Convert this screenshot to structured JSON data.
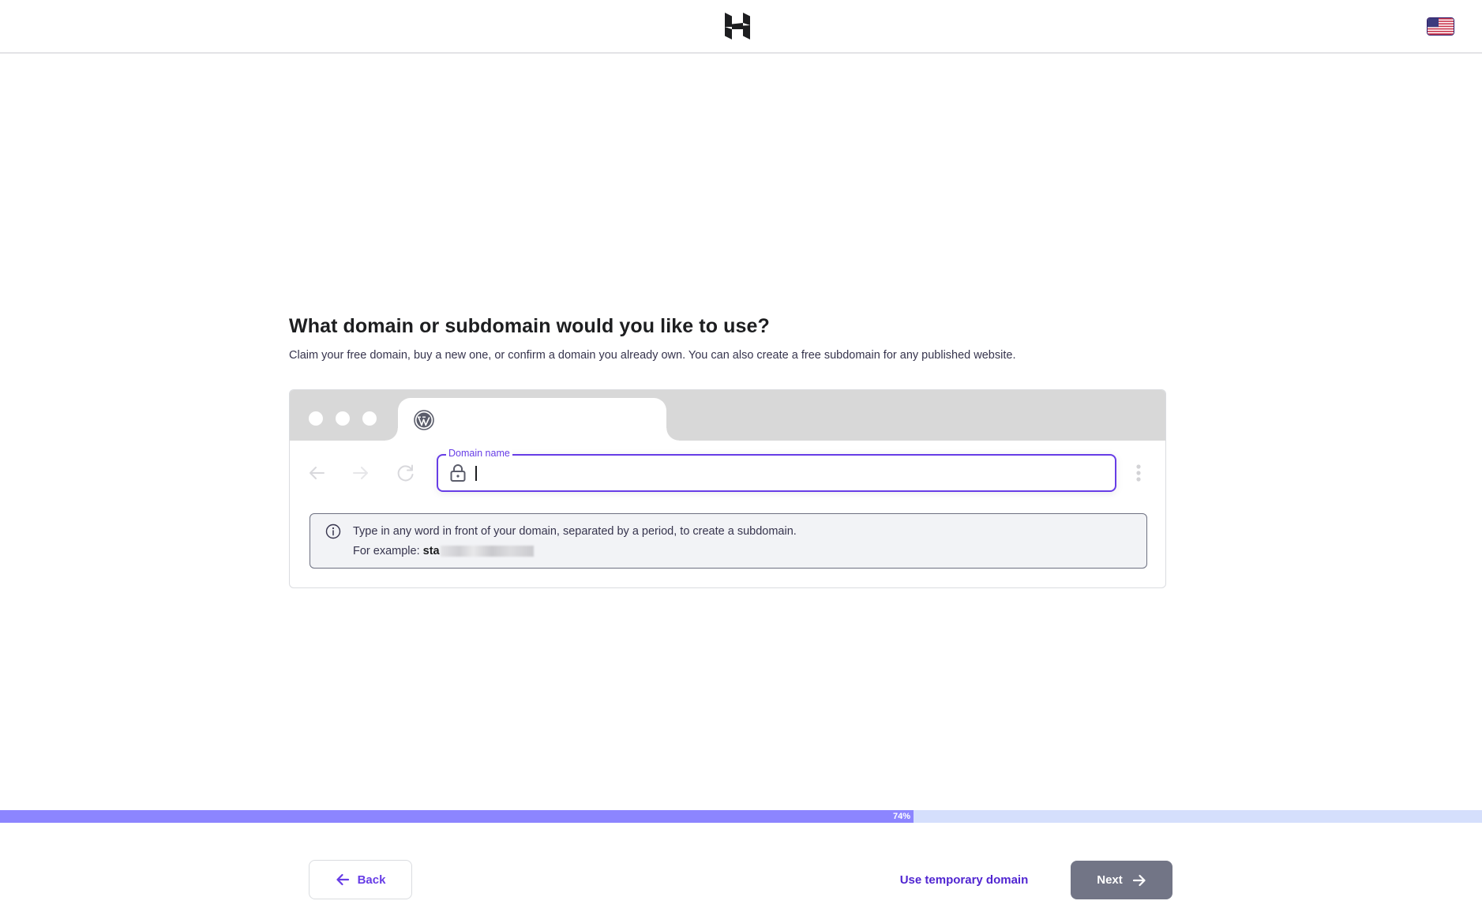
{
  "header": {
    "logo_icon": "hostinger-h-logo-icon",
    "language_icon": "us-flag-icon"
  },
  "page": {
    "title": "What domain or subdomain would you like to use?",
    "subtitle": "Claim your free domain, buy a new one, or confirm a domain you already own. You can also create a free subdomain for any published website."
  },
  "browser_mock": {
    "tab_icon": "wordpress-icon",
    "nav_icons": [
      "arrow-left-icon",
      "arrow-right-icon",
      "reload-icon"
    ],
    "domain_field": {
      "label": "Domain name",
      "value": "",
      "icon": "lock-icon"
    },
    "menu_icon": "kebab-menu-icon"
  },
  "info_box": {
    "icon": "info-icon",
    "line1": "Type in any word in front of your domain, separated by a period, to create a subdomain.",
    "example_label": "For example:",
    "example_value_visible": "sta"
  },
  "progress": {
    "percent": 74,
    "label": "74%",
    "colors": {
      "fill": "#8c85ff",
      "track": "#d5dffc"
    }
  },
  "footer": {
    "back_label": "Back",
    "temp_domain_label": "Use temporary domain",
    "next_label": "Next"
  },
  "colors": {
    "accent": "#673de6",
    "link": "#5025d1",
    "next_disabled": "#727586"
  }
}
